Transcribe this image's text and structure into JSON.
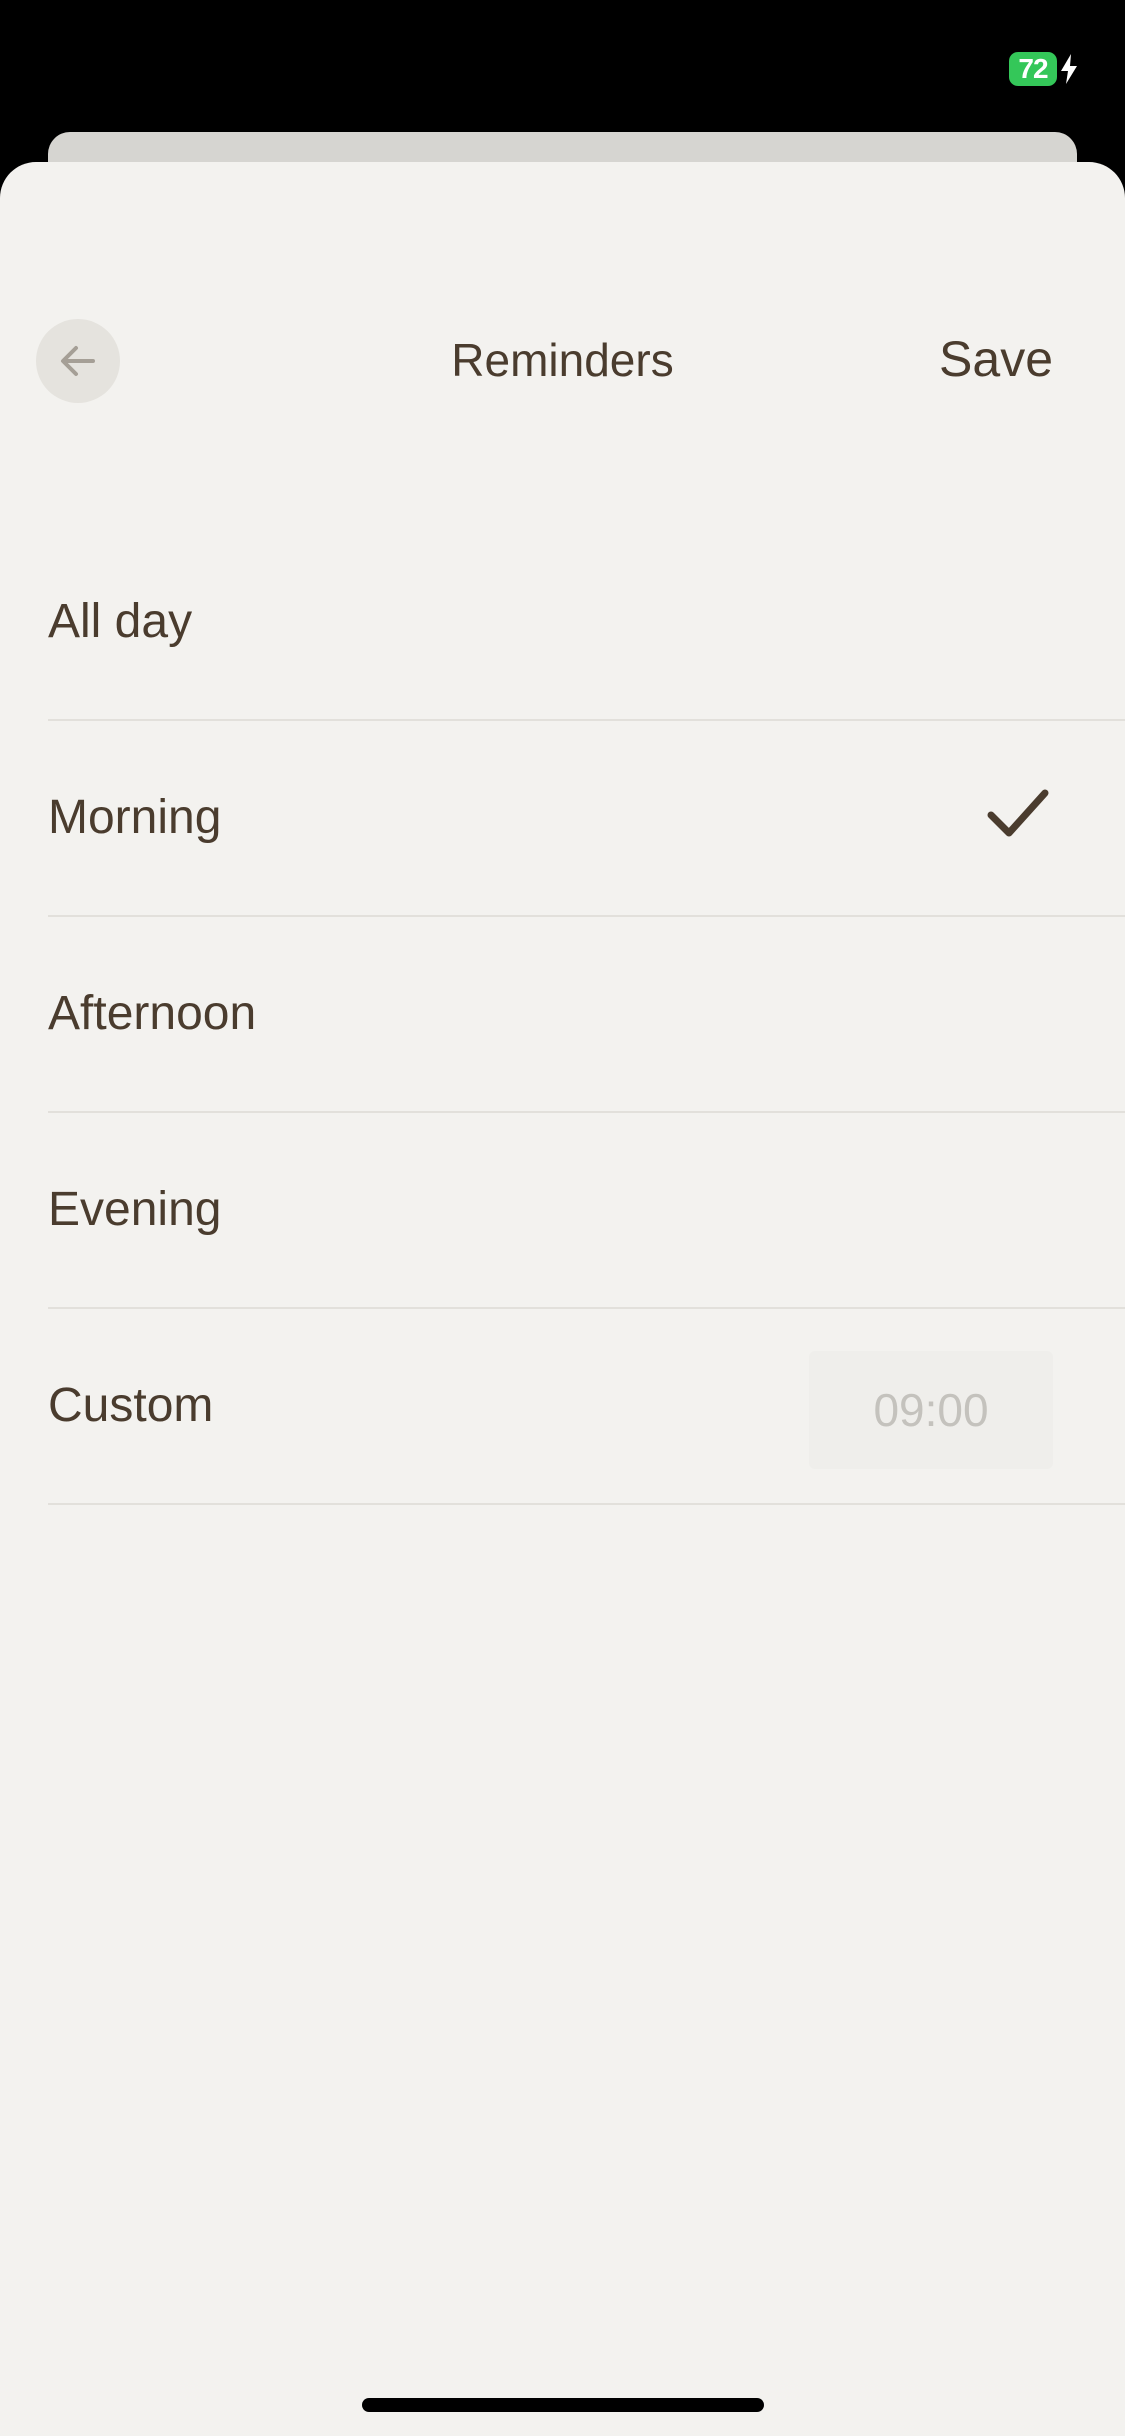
{
  "status_bar": {
    "battery_level": "72",
    "battery_color": "#34c759",
    "charging_icon": "bolt-icon"
  },
  "header": {
    "title": "Reminders",
    "save_label": "Save",
    "back_icon": "arrow-left-icon"
  },
  "options": [
    {
      "label": "All day",
      "selected": false
    },
    {
      "label": "Morning",
      "selected": true
    },
    {
      "label": "Afternoon",
      "selected": false
    },
    {
      "label": "Evening",
      "selected": false
    },
    {
      "label": "Custom",
      "selected": false,
      "time_value": "09:00"
    }
  ],
  "colors": {
    "sheet_background": "#f3f2ef",
    "text_primary": "#4a3c2e",
    "divider": "#e2e0db",
    "time_text": "#c4c2bd"
  }
}
